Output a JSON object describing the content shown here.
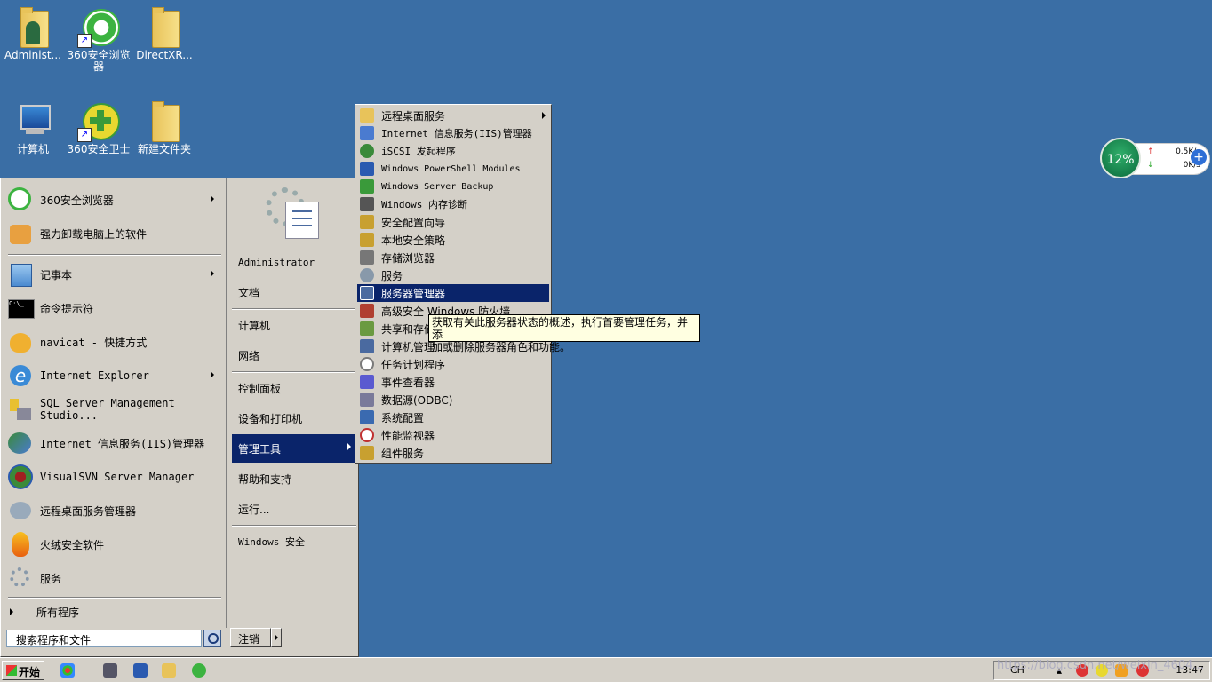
{
  "desktop": {
    "icons": [
      {
        "label": "Administ...",
        "icon": "user-folder-icon"
      },
      {
        "label": "360安全浏览器",
        "icon": "browser-360-icon"
      },
      {
        "label": "DirectXR...",
        "icon": "folder-icon"
      },
      {
        "label": "计算机",
        "icon": "computer-icon"
      },
      {
        "label": "360安全卫士",
        "icon": "security-360-icon"
      },
      {
        "label": "新建文件夹",
        "icon": "folder-icon"
      }
    ]
  },
  "start_menu": {
    "left_items": [
      {
        "label": "360安全浏览器",
        "icon": "browser-360-icon",
        "has_submenu": true
      },
      {
        "label": "强力卸载电脑上的软件",
        "icon": "uninstall-icon",
        "has_submenu": false
      },
      {
        "label": "记事本",
        "icon": "notepad-icon",
        "has_submenu": true
      },
      {
        "label": "命令提示符",
        "icon": "cmd-icon",
        "has_submenu": false
      },
      {
        "label": "navicat - 快捷方式",
        "icon": "navicat-icon",
        "has_submenu": false
      },
      {
        "label": "Internet Explorer",
        "icon": "ie-icon",
        "has_submenu": true
      },
      {
        "label": "SQL Server Management Studio...",
        "icon": "sql-server-icon",
        "has_submenu": false
      },
      {
        "label": "Internet 信息服务(IIS)管理器",
        "icon": "iis-icon",
        "has_submenu": false
      },
      {
        "label": "VisualSVN Server Manager",
        "icon": "visualsvn-icon",
        "has_submenu": false
      },
      {
        "label": "远程桌面服务管理器",
        "icon": "remote-desktop-icon",
        "has_submenu": false
      },
      {
        "label": "火绒安全软件",
        "icon": "huorong-icon",
        "has_submenu": false
      },
      {
        "label": "服务",
        "icon": "services-icon",
        "has_submenu": false
      }
    ],
    "all_programs": "所有程序",
    "search_placeholder": "搜索程序和文件",
    "right_items": [
      {
        "label": "Administrator"
      },
      {
        "label": "文档"
      },
      {
        "label": "计算机"
      },
      {
        "label": "网络"
      },
      {
        "label": "控制面板"
      },
      {
        "label": "设备和打印机"
      },
      {
        "label": "管理工具"
      },
      {
        "label": "帮助和支持"
      },
      {
        "label": "运行..."
      },
      {
        "label": "Windows 安全"
      }
    ],
    "logout_label": "注销"
  },
  "admin_tools_menu": {
    "items": [
      {
        "label": "远程桌面服务",
        "icon": "folder-icon",
        "color": "#e8c35a"
      },
      {
        "label": "Internet 信息服务(IIS)管理器",
        "icon": "iis-icon",
        "color": "#4a7bd0"
      },
      {
        "label": "iSCSI 发起程序",
        "icon": "iscsi-icon",
        "color": "#3a8a3a"
      },
      {
        "label": "Windows PowerShell Modules",
        "icon": "powershell-icon",
        "color": "#2a5ab0"
      },
      {
        "label": "Windows Server Backup",
        "icon": "backup-icon",
        "color": "#3a9a3a"
      },
      {
        "label": "Windows 内存诊断",
        "icon": "memory-icon",
        "color": "#555555"
      },
      {
        "label": "安全配置向导",
        "icon": "security-wizard-icon",
        "color": "#c8a030"
      },
      {
        "label": "本地安全策略",
        "icon": "local-policy-icon",
        "color": "#c8a030"
      },
      {
        "label": "存储浏览器",
        "icon": "storage-icon",
        "color": "#777777"
      },
      {
        "label": "服务",
        "icon": "services-icon",
        "color": "#8899aa"
      },
      {
        "label": "服务器管理器",
        "icon": "server-manager-icon",
        "color": "#4a6aa0"
      },
      {
        "label": "高级安全 Windows 防火墙",
        "icon": "firewall-icon",
        "color": "#b04030"
      },
      {
        "label": "共享和存储管理",
        "icon": "share-storage-icon",
        "color": "#6a9a40"
      },
      {
        "label": "计算机管理",
        "icon": "computer-management-icon",
        "color": "#4a6aa0"
      },
      {
        "label": "任务计划程序",
        "icon": "task-scheduler-icon",
        "color": "#7a7a7a"
      },
      {
        "label": "事件查看器",
        "icon": "event-viewer-icon",
        "color": "#5a5ad0"
      },
      {
        "label": "数据源(ODBC)",
        "icon": "odbc-icon",
        "color": "#7a7a9a"
      },
      {
        "label": "系统配置",
        "icon": "msconfig-icon",
        "color": "#3a6ab0"
      },
      {
        "label": "性能监视器",
        "icon": "perfmon-icon",
        "color": "#c03030"
      },
      {
        "label": "组件服务",
        "icon": "component-services-icon",
        "color": "#c8a030"
      }
    ],
    "tooltip_line1": "获取有关此服务器状态的概述，执行首要管理任务，并添",
    "tooltip_line2": "加或删除服务器角色和功能。"
  },
  "speed_widget": {
    "percent": "12%",
    "upload": "0.5K/s",
    "download": "0K/s"
  },
  "taskbar": {
    "start_label": "开始",
    "ime_label": "CH",
    "clock": "13:47",
    "watermark": "https://blog.csdn.net/weixin_4604..."
  },
  "colors": {
    "desktop": "#3a6ea5",
    "highlight": "#0a246a",
    "menu_bg": "#d4d0c8",
    "tooltip_bg": "#ffffe1"
  }
}
